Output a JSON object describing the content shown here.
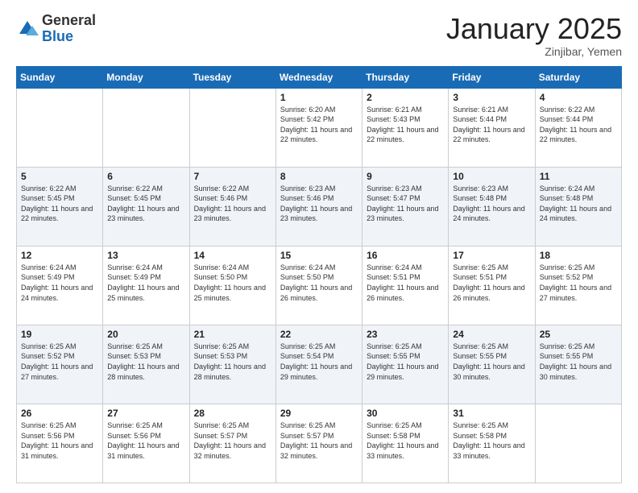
{
  "header": {
    "logo_general": "General",
    "logo_blue": "Blue",
    "month": "January 2025",
    "location": "Zinjibar, Yemen"
  },
  "days_of_week": [
    "Sunday",
    "Monday",
    "Tuesday",
    "Wednesday",
    "Thursday",
    "Friday",
    "Saturday"
  ],
  "weeks": [
    [
      {
        "day": "",
        "sunrise": "",
        "sunset": "",
        "daylight": ""
      },
      {
        "day": "",
        "sunrise": "",
        "sunset": "",
        "daylight": ""
      },
      {
        "day": "",
        "sunrise": "",
        "sunset": "",
        "daylight": ""
      },
      {
        "day": "1",
        "sunrise": "Sunrise: 6:20 AM",
        "sunset": "Sunset: 5:42 PM",
        "daylight": "Daylight: 11 hours and 22 minutes."
      },
      {
        "day": "2",
        "sunrise": "Sunrise: 6:21 AM",
        "sunset": "Sunset: 5:43 PM",
        "daylight": "Daylight: 11 hours and 22 minutes."
      },
      {
        "day": "3",
        "sunrise": "Sunrise: 6:21 AM",
        "sunset": "Sunset: 5:44 PM",
        "daylight": "Daylight: 11 hours and 22 minutes."
      },
      {
        "day": "4",
        "sunrise": "Sunrise: 6:22 AM",
        "sunset": "Sunset: 5:44 PM",
        "daylight": "Daylight: 11 hours and 22 minutes."
      }
    ],
    [
      {
        "day": "5",
        "sunrise": "Sunrise: 6:22 AM",
        "sunset": "Sunset: 5:45 PM",
        "daylight": "Daylight: 11 hours and 22 minutes."
      },
      {
        "day": "6",
        "sunrise": "Sunrise: 6:22 AM",
        "sunset": "Sunset: 5:45 PM",
        "daylight": "Daylight: 11 hours and 23 minutes."
      },
      {
        "day": "7",
        "sunrise": "Sunrise: 6:22 AM",
        "sunset": "Sunset: 5:46 PM",
        "daylight": "Daylight: 11 hours and 23 minutes."
      },
      {
        "day": "8",
        "sunrise": "Sunrise: 6:23 AM",
        "sunset": "Sunset: 5:46 PM",
        "daylight": "Daylight: 11 hours and 23 minutes."
      },
      {
        "day": "9",
        "sunrise": "Sunrise: 6:23 AM",
        "sunset": "Sunset: 5:47 PM",
        "daylight": "Daylight: 11 hours and 23 minutes."
      },
      {
        "day": "10",
        "sunrise": "Sunrise: 6:23 AM",
        "sunset": "Sunset: 5:48 PM",
        "daylight": "Daylight: 11 hours and 24 minutes."
      },
      {
        "day": "11",
        "sunrise": "Sunrise: 6:24 AM",
        "sunset": "Sunset: 5:48 PM",
        "daylight": "Daylight: 11 hours and 24 minutes."
      }
    ],
    [
      {
        "day": "12",
        "sunrise": "Sunrise: 6:24 AM",
        "sunset": "Sunset: 5:49 PM",
        "daylight": "Daylight: 11 hours and 24 minutes."
      },
      {
        "day": "13",
        "sunrise": "Sunrise: 6:24 AM",
        "sunset": "Sunset: 5:49 PM",
        "daylight": "Daylight: 11 hours and 25 minutes."
      },
      {
        "day": "14",
        "sunrise": "Sunrise: 6:24 AM",
        "sunset": "Sunset: 5:50 PM",
        "daylight": "Daylight: 11 hours and 25 minutes."
      },
      {
        "day": "15",
        "sunrise": "Sunrise: 6:24 AM",
        "sunset": "Sunset: 5:50 PM",
        "daylight": "Daylight: 11 hours and 26 minutes."
      },
      {
        "day": "16",
        "sunrise": "Sunrise: 6:24 AM",
        "sunset": "Sunset: 5:51 PM",
        "daylight": "Daylight: 11 hours and 26 minutes."
      },
      {
        "day": "17",
        "sunrise": "Sunrise: 6:25 AM",
        "sunset": "Sunset: 5:51 PM",
        "daylight": "Daylight: 11 hours and 26 minutes."
      },
      {
        "day": "18",
        "sunrise": "Sunrise: 6:25 AM",
        "sunset": "Sunset: 5:52 PM",
        "daylight": "Daylight: 11 hours and 27 minutes."
      }
    ],
    [
      {
        "day": "19",
        "sunrise": "Sunrise: 6:25 AM",
        "sunset": "Sunset: 5:52 PM",
        "daylight": "Daylight: 11 hours and 27 minutes."
      },
      {
        "day": "20",
        "sunrise": "Sunrise: 6:25 AM",
        "sunset": "Sunset: 5:53 PM",
        "daylight": "Daylight: 11 hours and 28 minutes."
      },
      {
        "day": "21",
        "sunrise": "Sunrise: 6:25 AM",
        "sunset": "Sunset: 5:53 PM",
        "daylight": "Daylight: 11 hours and 28 minutes."
      },
      {
        "day": "22",
        "sunrise": "Sunrise: 6:25 AM",
        "sunset": "Sunset: 5:54 PM",
        "daylight": "Daylight: 11 hours and 29 minutes."
      },
      {
        "day": "23",
        "sunrise": "Sunrise: 6:25 AM",
        "sunset": "Sunset: 5:55 PM",
        "daylight": "Daylight: 11 hours and 29 minutes."
      },
      {
        "day": "24",
        "sunrise": "Sunrise: 6:25 AM",
        "sunset": "Sunset: 5:55 PM",
        "daylight": "Daylight: 11 hours and 30 minutes."
      },
      {
        "day": "25",
        "sunrise": "Sunrise: 6:25 AM",
        "sunset": "Sunset: 5:55 PM",
        "daylight": "Daylight: 11 hours and 30 minutes."
      }
    ],
    [
      {
        "day": "26",
        "sunrise": "Sunrise: 6:25 AM",
        "sunset": "Sunset: 5:56 PM",
        "daylight": "Daylight: 11 hours and 31 minutes."
      },
      {
        "day": "27",
        "sunrise": "Sunrise: 6:25 AM",
        "sunset": "Sunset: 5:56 PM",
        "daylight": "Daylight: 11 hours and 31 minutes."
      },
      {
        "day": "28",
        "sunrise": "Sunrise: 6:25 AM",
        "sunset": "Sunset: 5:57 PM",
        "daylight": "Daylight: 11 hours and 32 minutes."
      },
      {
        "day": "29",
        "sunrise": "Sunrise: 6:25 AM",
        "sunset": "Sunset: 5:57 PM",
        "daylight": "Daylight: 11 hours and 32 minutes."
      },
      {
        "day": "30",
        "sunrise": "Sunrise: 6:25 AM",
        "sunset": "Sunset: 5:58 PM",
        "daylight": "Daylight: 11 hours and 33 minutes."
      },
      {
        "day": "31",
        "sunrise": "Sunrise: 6:25 AM",
        "sunset": "Sunset: 5:58 PM",
        "daylight": "Daylight: 11 hours and 33 minutes."
      },
      {
        "day": "",
        "sunrise": "",
        "sunset": "",
        "daylight": ""
      }
    ]
  ]
}
